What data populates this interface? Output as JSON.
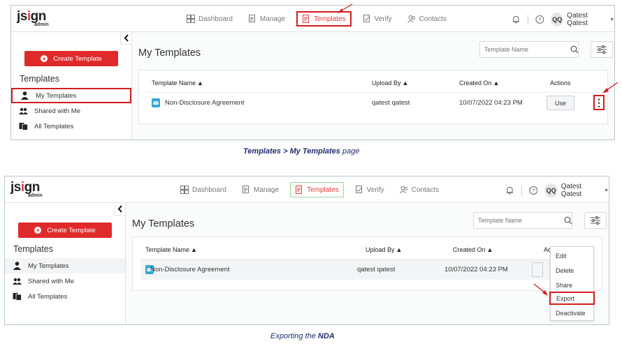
{
  "app": {
    "logo_text_1": "js",
    "logo_text_2": "i",
    "logo_text_3": "gn",
    "logo_sub": "admin"
  },
  "nav": [
    {
      "label": "Dashboard",
      "icon": "dashboard-icon"
    },
    {
      "label": "Manage",
      "icon": "manage-icon"
    },
    {
      "label": "Templates",
      "icon": "templates-icon",
      "active": true
    },
    {
      "label": "Verify",
      "icon": "verify-icon"
    },
    {
      "label": "Contacts",
      "icon": "contacts-icon"
    }
  ],
  "user": {
    "initials": "QQ",
    "name": "Qatest Qatest"
  },
  "sidebar": {
    "create_label": "Create Template",
    "heading": "Templates",
    "items": [
      {
        "label": "My Templates",
        "icon": "user-icon"
      },
      {
        "label": "Shared with Me",
        "icon": "users-icon"
      },
      {
        "label": "All Templates",
        "icon": "templates-stack-icon"
      }
    ]
  },
  "main": {
    "title": "My Templates",
    "search_placeholder": "Template Name",
    "columns": [
      "Template Name",
      "Upload By",
      "Created On",
      "Actions"
    ],
    "rows": [
      {
        "name": "Non-Disclosure Agreement",
        "upload_by": "qatest qatest",
        "created_on": "10/07/2022 04:23 PM",
        "action": "Use"
      }
    ]
  },
  "menu": {
    "items": [
      "Edit",
      "Delete",
      "Share",
      "Export",
      "Deactivate"
    ],
    "highlighted": "Export"
  },
  "columns_short": {
    "actions_partial": "Ac"
  },
  "captions": {
    "top_part1": "Templates",
    "top_sep": " > ",
    "top_part2": "My Templates",
    "top_part3": " page",
    "bottom_part1": "Exporting the ",
    "bottom_part2": "NDA"
  },
  "colors": {
    "accent": "#e02a2a",
    "highlight_box": "#d11d1d",
    "caption": "#1f2d6b"
  }
}
